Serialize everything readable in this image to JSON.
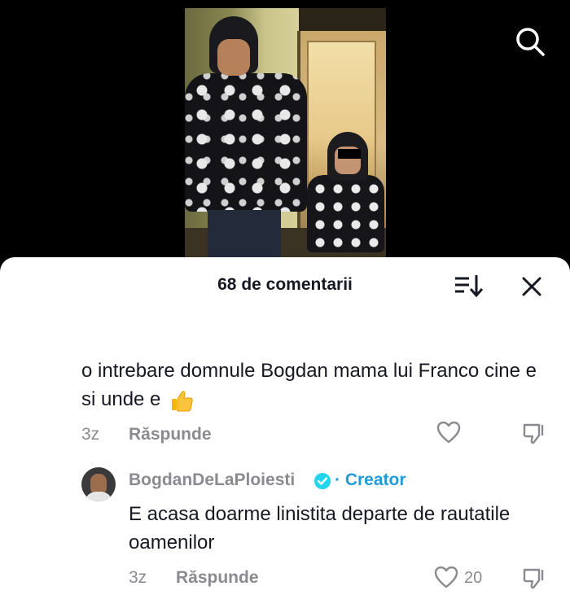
{
  "header": {
    "search_icon": "search-icon"
  },
  "comments_panel": {
    "title": "68 de comentarii",
    "sort_icon": "sort-icon",
    "close_icon": "close-icon"
  },
  "comments": [
    {
      "text": "o intrebare domnule Bogdan mama lui Franco cine e si unde e",
      "emoji": "thumbs-up-icon",
      "time": "3z",
      "reply_label": "Răspunde",
      "likes": ""
    },
    {
      "username": "BogdanDeLaPloiesti",
      "badge": "· Creator",
      "text": "E acasa doarme linistita departe de rautatile oamenilor",
      "time": "3z",
      "reply_label": "Răspunde",
      "likes": "20"
    }
  ],
  "colors": {
    "accent_blue": "#1f9bd8",
    "muted_gray": "#8a8b91",
    "text_dark": "#161823"
  }
}
